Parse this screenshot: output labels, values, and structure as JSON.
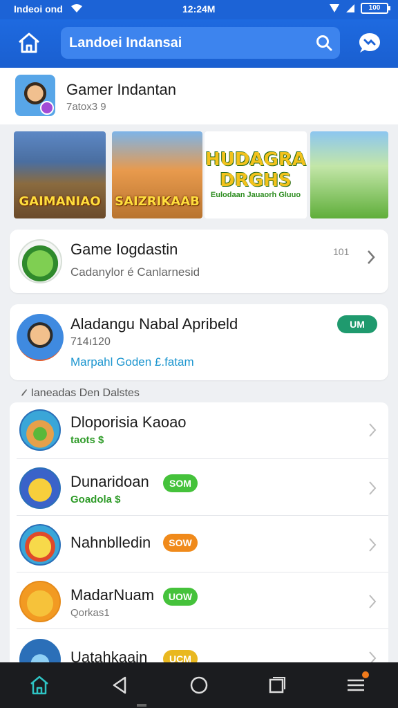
{
  "status_bar": {
    "left_text": "Indeoi ond",
    "time": "12:24M",
    "battery": "100"
  },
  "header": {
    "search_text": "Landoei Indansai"
  },
  "profile": {
    "name": "Gamer Indantan",
    "subtitle": "7atox3 9"
  },
  "banners": [
    {
      "label": "GAIMANIAO"
    },
    {
      "label": "SAIZRIKAAB"
    },
    {
      "label": "HUDAGRA DRGHS",
      "tagline": "Eulodaan Jauaorh Gluuo"
    },
    {
      "label": ""
    }
  ],
  "game_card": {
    "title": "Game Iogdastin",
    "subtitle": "Cadanylor é Canlarnesid",
    "count": "101"
  },
  "app_card": {
    "title": "Aladangu Nabal Apribeld",
    "meta": "714ı120",
    "link": "Marpahl Goden £.fatam",
    "badge": "UM"
  },
  "section": {
    "label": "Ianeadas Den Dalstes"
  },
  "list_items": [
    {
      "title": "Dloporisia Kaoao",
      "sub": "taots $",
      "badge": ""
    },
    {
      "title": "Dunaridoan",
      "sub": "Goadola $",
      "badge": "SOM"
    },
    {
      "title": "Nahnblledin",
      "sub": "",
      "badge": "SOW"
    },
    {
      "title": "MadarNuam",
      "sub": "Qorkas1",
      "badge": "UOW"
    },
    {
      "title": "Uatahkaain",
      "sub": "",
      "badge": "UCM"
    }
  ],
  "colors": {
    "primary": "#1c63d6",
    "accent_green": "#45c23b",
    "accent_orange": "#f08a1b",
    "teal": "#1f9a6e",
    "nav_bg": "#1b1c1f"
  },
  "icons": [
    "home-icon",
    "search-icon",
    "chat-icon",
    "chevron-right-icon",
    "back-icon",
    "circle-home-icon",
    "recents-icon",
    "menu-icon"
  ]
}
